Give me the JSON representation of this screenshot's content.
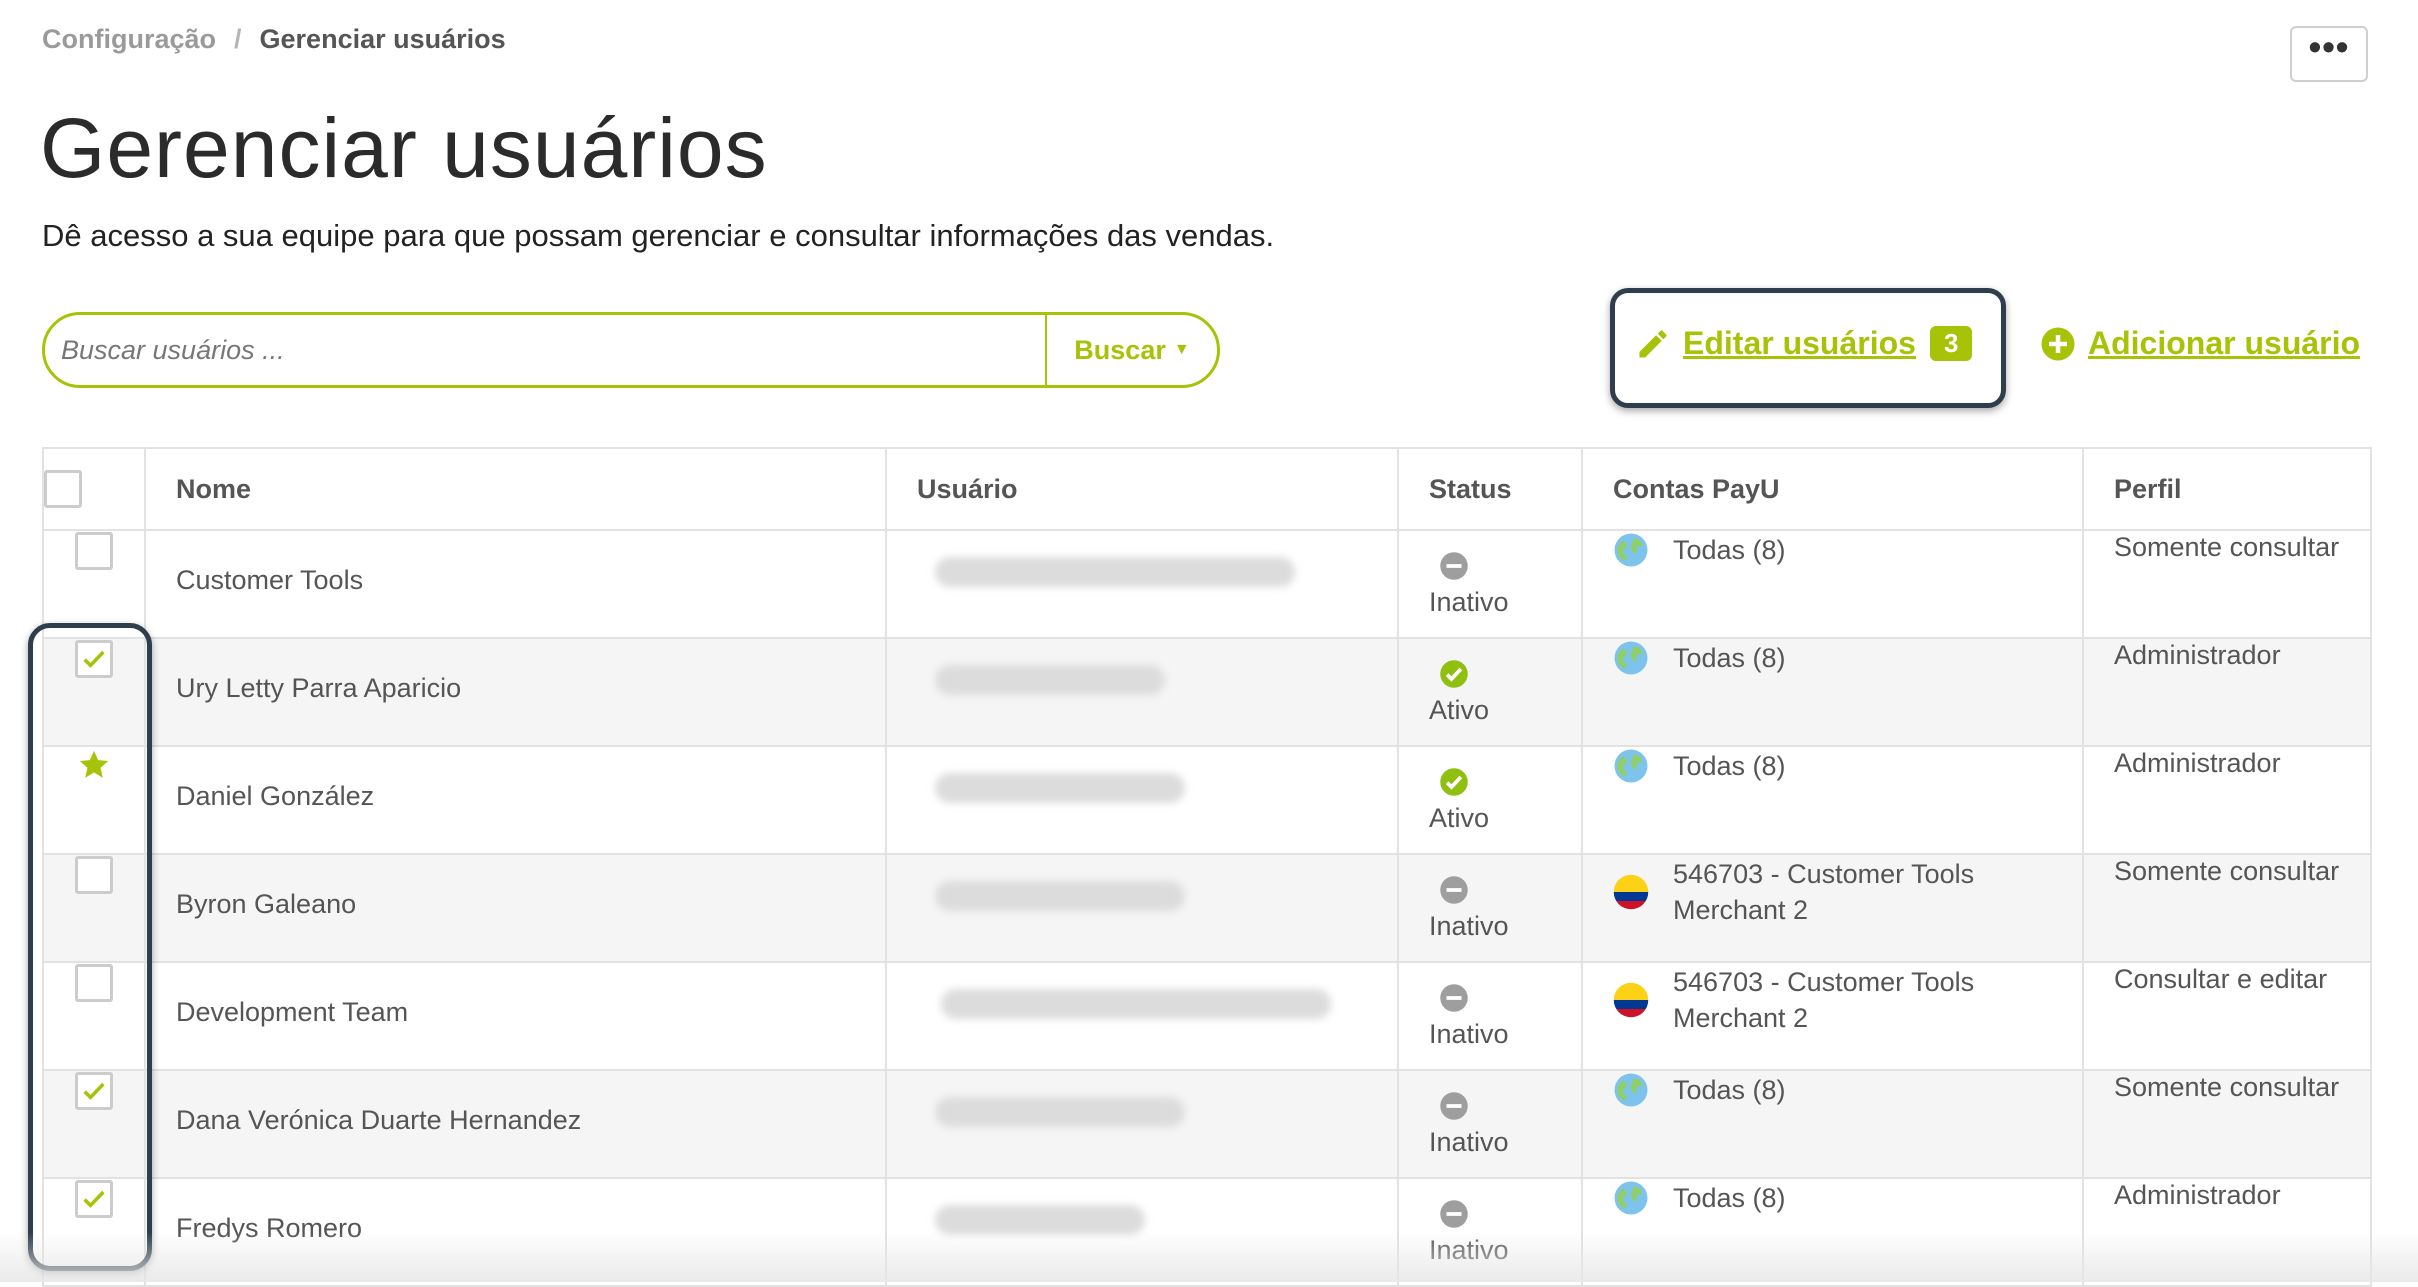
{
  "breadcrumb": {
    "parent": "Configuração",
    "separator": "/",
    "current": "Gerenciar usuários"
  },
  "page": {
    "title": "Gerenciar usuários",
    "subtitle": "Dê acesso a sua equipe para que possam gerenciar e consultar informações das vendas."
  },
  "more_button": {
    "label": "•••"
  },
  "search": {
    "placeholder": "Buscar usuários ...",
    "button_label": "Buscar"
  },
  "actions": {
    "edit_label": "Editar usuários",
    "edit_count": "3",
    "add_label": "Adicionar usuário"
  },
  "table": {
    "headers": {
      "name": "Nome",
      "user": "Usuário",
      "status": "Status",
      "accounts": "Contas PayU",
      "profile": "Perfil"
    },
    "rows": [
      {
        "selection": "unchecked",
        "name": "Customer Tools",
        "status": "Inativo",
        "status_kind": "inactive",
        "account_icon": "globe",
        "account": "Todas (8)",
        "profile": "Somente consultar"
      },
      {
        "selection": "checked",
        "name": "Ury Letty Parra Aparicio",
        "status": "Ativo",
        "status_kind": "active",
        "account_icon": "globe",
        "account": "Todas (8)",
        "profile": "Administrador"
      },
      {
        "selection": "star",
        "name": "Daniel González",
        "status": "Ativo",
        "status_kind": "active",
        "account_icon": "globe",
        "account": "Todas (8)",
        "profile": "Administrador"
      },
      {
        "selection": "unchecked",
        "name": "Byron Galeano",
        "status": "Inativo",
        "status_kind": "inactive",
        "account_icon": "colombia-flag",
        "account": "546703 - Customer Tools Merchant 2",
        "profile": "Somente consultar"
      },
      {
        "selection": "unchecked",
        "name": "Development Team",
        "status": "Inativo",
        "status_kind": "inactive",
        "account_icon": "colombia-flag",
        "account": "546703 - Customer Tools Merchant 2",
        "profile": "Consultar e editar"
      },
      {
        "selection": "checked",
        "name": "Dana Verónica Duarte Hernandez",
        "status": "Inativo",
        "status_kind": "inactive",
        "account_icon": "globe",
        "account": "Todas (8)",
        "profile": "Somente consultar"
      },
      {
        "selection": "checked",
        "name": "Fredys Romero",
        "status": "Inativo",
        "status_kind": "inactive",
        "account_icon": "globe",
        "account": "Todas (8)",
        "profile": "Administrador"
      }
    ]
  },
  "colors": {
    "accent": "#a6c307",
    "active_status": "#8fbf0f",
    "inactive_status": "#9e9e9e",
    "highlight_border": "#2f3e4c"
  },
  "icons": {
    "more": "ellipsis-icon",
    "edit": "pencil-icon",
    "add": "plus-circle-icon",
    "dropdown": "caret-down-icon",
    "active": "check-circle-icon",
    "inactive": "minus-circle-icon",
    "all_accounts": "globe-icon",
    "country": "colombia-flag-icon",
    "favorite": "star-icon"
  }
}
